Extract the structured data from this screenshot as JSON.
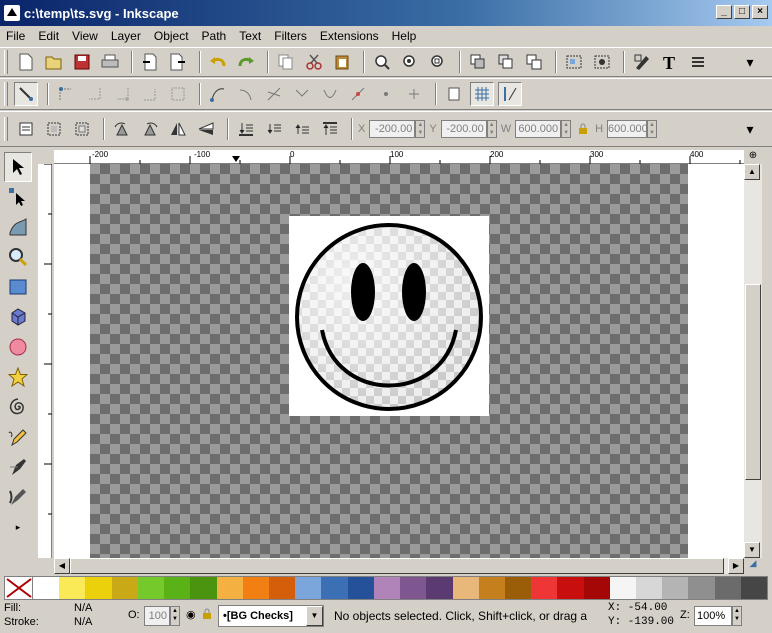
{
  "window": {
    "title": "c:\\temp\\ts.svg - Inkscape"
  },
  "menu": [
    "File",
    "Edit",
    "View",
    "Layer",
    "Object",
    "Path",
    "Text",
    "Filters",
    "Extensions",
    "Help"
  ],
  "toolbar2": {
    "x_label": "X",
    "x_value": "-200.00",
    "y_label": "Y",
    "y_value": "-200.00",
    "w_label": "W",
    "w_value": "600.000",
    "h_label": "H",
    "h_value": "600.000"
  },
  "ruler_h": [
    "-200",
    "-100",
    "0",
    "100",
    "200",
    "300",
    "400"
  ],
  "palette": [
    "#ffffff",
    "#fbea58",
    "#ead10b",
    "#c9a916",
    "#76c92a",
    "#5ab216",
    "#4a9410",
    "#f5b042",
    "#f17f12",
    "#d45e09",
    "#7aa6db",
    "#3c6fb4",
    "#24519a",
    "#b084b8",
    "#7e5690",
    "#5b3a72",
    "#e8b87a",
    "#c57f1c",
    "#9a5d08",
    "#ef3636",
    "#c90e0e",
    "#a50606",
    "#f5f5f5",
    "#d7d7d7",
    "#b4b4b4",
    "#8f8f8f",
    "#6b6b6b",
    "#464646"
  ],
  "status": {
    "fill_label": "Fill:",
    "fill_value": "N/A",
    "stroke_label": "Stroke:",
    "stroke_value": "N/A",
    "opacity_label": "O:",
    "opacity_value": "100",
    "layer": "•[BG Checks]",
    "message": "No objects selected. Click, Shift+click, or drag a",
    "x_coord": "X:  -54.00",
    "y_coord": "Y: -139.00",
    "zoom_label": "Z:",
    "zoom_value": "100%"
  }
}
